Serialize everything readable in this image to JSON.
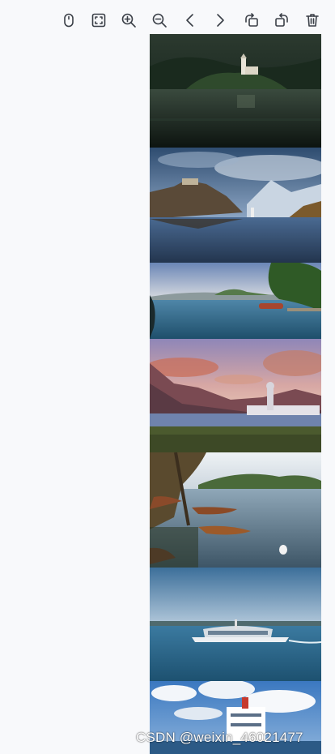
{
  "toolbar": {
    "tools": [
      {
        "name": "mouse-mode",
        "icon": "mouse-icon"
      },
      {
        "name": "fullscreen",
        "icon": "fullscreen-icon"
      },
      {
        "name": "zoom-in",
        "icon": "zoom-in-icon"
      },
      {
        "name": "zoom-out",
        "icon": "zoom-out-icon"
      },
      {
        "name": "previous",
        "icon": "chevron-left-icon"
      },
      {
        "name": "next",
        "icon": "chevron-right-icon"
      },
      {
        "name": "rotate-left",
        "icon": "rotate-left-icon"
      },
      {
        "name": "rotate-right",
        "icon": "rotate-right-icon"
      },
      {
        "name": "delete",
        "icon": "trash-icon"
      }
    ],
    "icon_color": "#3a3f47"
  },
  "images": [
    {
      "subject": "lake island church at dusk"
    },
    {
      "subject": "castle on cliff over lake"
    },
    {
      "subject": "lakeshore with boats and tree"
    },
    {
      "subject": "mountain lake pier at sunset"
    },
    {
      "subject": "rowing boats and swan on lake"
    },
    {
      "subject": "ferry boat on blue lake"
    },
    {
      "subject": "white ferry under clouds"
    }
  ],
  "watermark": "CSDN @weixin_46021477",
  "background": "#f8f9fb"
}
